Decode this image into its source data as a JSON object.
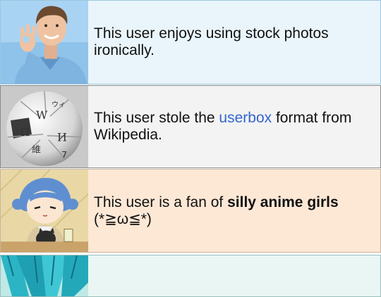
{
  "userboxes": [
    {
      "image": "stock-photo-man-ok-gesture",
      "text": "This user enjoys using stock photos ironically."
    },
    {
      "image": "wikipedia-globe-logo",
      "text_before": "This user stole the ",
      "link": "userbox",
      "text_after": " format from Wikipedia."
    },
    {
      "image": "anime-girl-with-cat",
      "text_before": "This user is a fan of ",
      "bold": "silly anime girls",
      "text_after": " (*≧ω≦*)"
    },
    {
      "image": "anime-teal-hair",
      "text": ""
    }
  ],
  "colors": {
    "link": "#3366cc",
    "box1_bg": "#e9f5fb",
    "box2_bg": "#f3f3f3",
    "box3_bg": "#fde8d5"
  }
}
